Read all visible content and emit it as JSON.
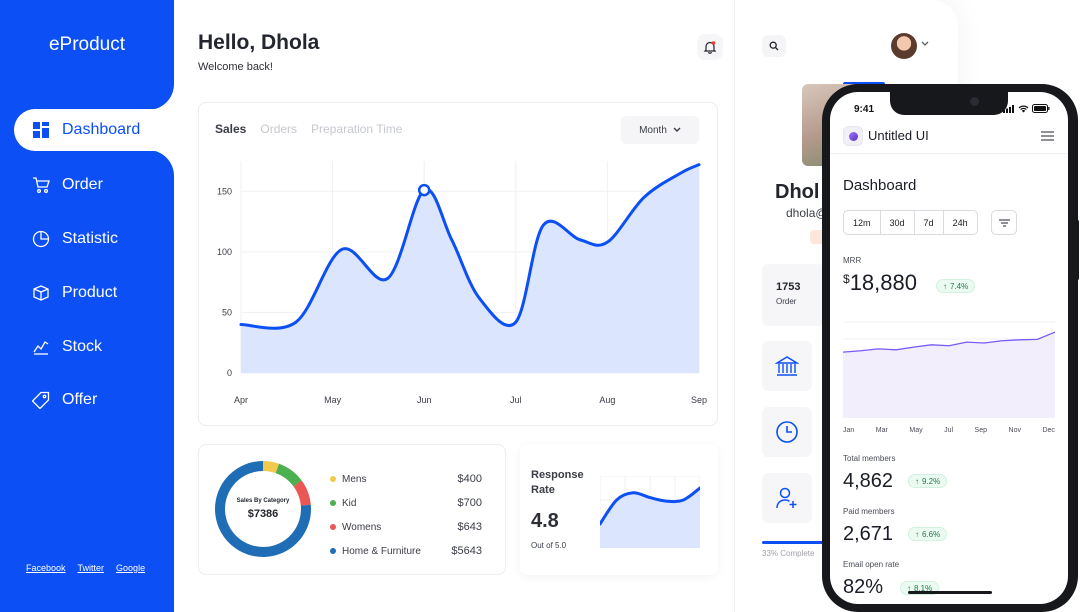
{
  "sidebar": {
    "brand": "eProduct",
    "items": [
      {
        "label": "Dashboard",
        "icon": "dashboard-grid-icon"
      },
      {
        "label": "Order",
        "icon": "cart-icon"
      },
      {
        "label": "Statistic",
        "icon": "pie-chart-icon"
      },
      {
        "label": "Product",
        "icon": "box-icon"
      },
      {
        "label": "Stock",
        "icon": "stock-icon"
      },
      {
        "label": "Offer",
        "icon": "tag-icon"
      }
    ],
    "footer_links": [
      "Facebook",
      "Twitter",
      "Google"
    ]
  },
  "header": {
    "greeting": "Hello, Dhola",
    "subtitle": "Welcome back!"
  },
  "sales_card": {
    "tabs": [
      "Sales",
      "Orders",
      "Preparation Time"
    ],
    "period": "Month"
  },
  "category_card": {
    "center_title": "Sales By Category",
    "center_value": "$7386",
    "items": [
      {
        "name": "Mens",
        "amount": "$400",
        "color": "#f2c94c"
      },
      {
        "name": "Kid",
        "amount": "$700",
        "color": "#4caf50"
      },
      {
        "name": "Womens",
        "amount": "$643",
        "color": "#eb5757"
      },
      {
        "name": "Home & Furniture",
        "amount": "$5643",
        "color": "#1f6db5"
      }
    ]
  },
  "response_card": {
    "title": "Response Rate",
    "value": "4.8",
    "sub": "Out of 5.0"
  },
  "profile": {
    "name": "Dhol",
    "email": "dhola@",
    "stat_value": "1753",
    "stat_label": "Order",
    "progress_text": "33% Complete"
  },
  "phone": {
    "time": "9:41",
    "app_name": "Untitled UI",
    "title": "Dashboard",
    "ranges": [
      "12m",
      "30d",
      "7d",
      "24h"
    ],
    "mrr": {
      "label": "MRR",
      "currency": "$",
      "value": "18,880",
      "change": "7.4%"
    },
    "months": [
      "Jan",
      "Mar",
      "May",
      "Jul",
      "Sep",
      "Nov",
      "Dec"
    ],
    "metrics": [
      {
        "label": "Total members",
        "value": "4,862",
        "change": "9.2%"
      },
      {
        "label": "Paid members",
        "value": "2,671",
        "change": "6.6%"
      },
      {
        "label": "Email open rate",
        "value": "82%",
        "change": "8.1%"
      }
    ]
  },
  "colors": {
    "primary": "#0b4ff5",
    "area_fill": "#dbe5fd",
    "phone_line": "#7a5af8",
    "positive": "#1f7a45"
  },
  "chart_data": [
    {
      "type": "area",
      "name": "sales",
      "categories": [
        "Apr",
        "May",
        "Jun",
        "Jul",
        "Aug",
        "Sep"
      ],
      "x": [
        0,
        0.6,
        1.1,
        1.6,
        2.0,
        2.3,
        2.6,
        3.0,
        3.3,
        3.7,
        4.0,
        4.4,
        4.8,
        5.0
      ],
      "y": [
        40,
        42,
        102,
        78,
        151,
        110,
        62,
        42,
        122,
        110,
        108,
        145,
        165,
        172
      ],
      "ylim": [
        0,
        175
      ],
      "yticks": [
        0,
        50,
        100,
        150
      ],
      "highlight_index": 4,
      "grid": true
    },
    {
      "type": "pie",
      "name": "sales-by-category",
      "categories": [
        "Mens",
        "Kid",
        "Womens",
        "Home & Furniture"
      ],
      "values": [
        400,
        700,
        643,
        5643
      ]
    },
    {
      "type": "area",
      "name": "response-rate",
      "x": [
        0,
        1,
        2,
        3,
        4,
        5,
        6
      ],
      "y": [
        2,
        4,
        4.6,
        4.2,
        3.9,
        4.0,
        5.0
      ],
      "ylim": [
        0,
        6
      ]
    },
    {
      "type": "area",
      "name": "mrr",
      "categories": [
        "Jan",
        "Mar",
        "May",
        "Jul",
        "Sep",
        "Nov",
        "Dec"
      ],
      "x": [
        0,
        0.5,
        1,
        1.5,
        2,
        2.5,
        3,
        3.5,
        4,
        4.5,
        5,
        5.5,
        6
      ],
      "y": [
        14.5,
        14.8,
        15.2,
        15.0,
        15.6,
        16.1,
        15.9,
        16.7,
        16.5,
        17.0,
        17.2,
        17.3,
        18.9
      ],
      "ylim": [
        0,
        22
      ]
    }
  ]
}
